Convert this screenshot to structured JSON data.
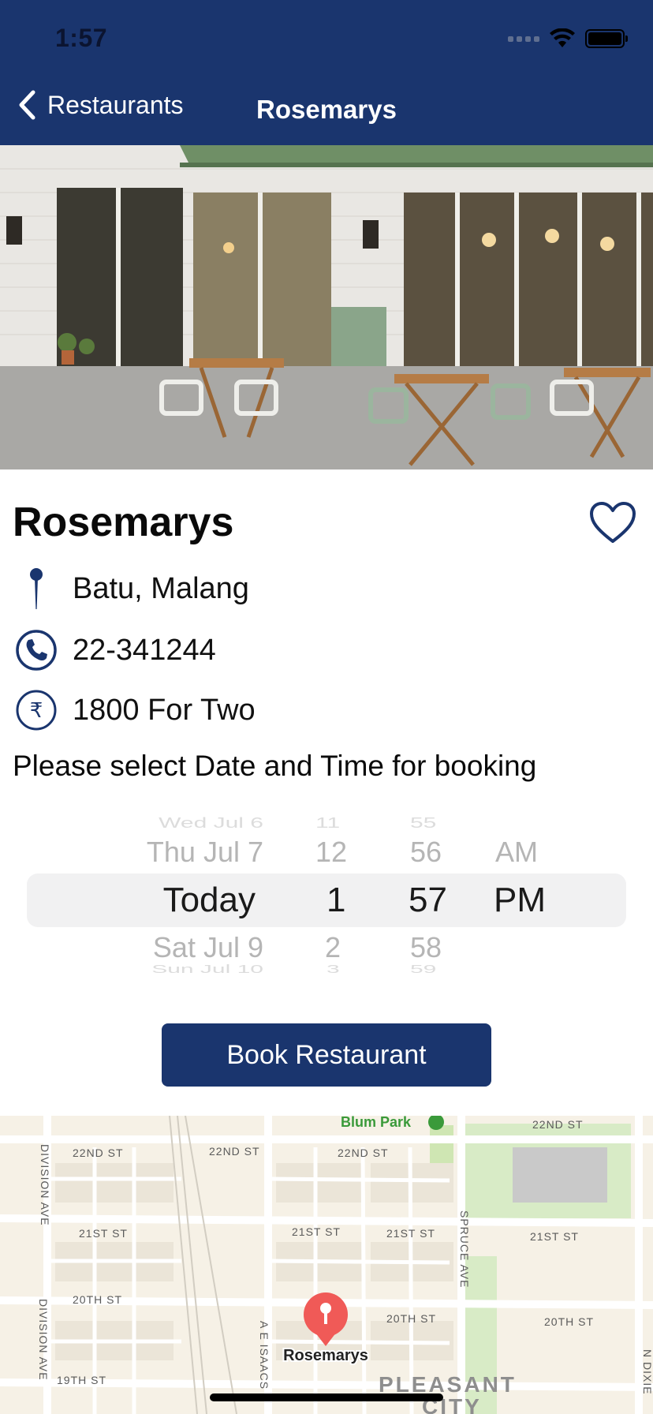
{
  "status_bar": {
    "time": "1:57"
  },
  "nav": {
    "back_label": "Restaurants",
    "title": "Rosemarys"
  },
  "restaurant": {
    "name": "Rosemarys",
    "location": "Batu, Malang",
    "phone": "22-341244",
    "price": "1800 For Two",
    "favorite": false
  },
  "booking": {
    "prompt": "Please select Date and Time for booking",
    "date_column": [
      "Wed Jul 6",
      "Thu Jul 7",
      "Today",
      "Sat Jul 9",
      "Sun Jul 10"
    ],
    "hour_column": [
      "11",
      "12",
      "1",
      "2",
      "3"
    ],
    "minute_column": [
      "55",
      "56",
      "57",
      "58",
      "59"
    ],
    "ampm_column": [
      "AM",
      "PM"
    ],
    "selected": {
      "date": "Today",
      "hour": "1",
      "minute": "57",
      "period": "PM"
    },
    "button_label": "Book Restaurant"
  },
  "map": {
    "pin_label": "Rosemarys",
    "park_label": "Blum Park",
    "street_labels": {
      "s22_a": "22ND ST",
      "s22_b": "22ND ST",
      "s22_c": "22ND ST",
      "s22_d": "22ND ST",
      "s21_a": "21ST ST",
      "s21_b": "21ST ST",
      "s21_c": "21ST ST",
      "s21_d": "21ST ST",
      "s20_a": "20TH ST",
      "s20_b": "20TH ST",
      "s20_c": "20TH ST",
      "s19_a": "19TH ST",
      "division_a": "DIVISION AVE",
      "division_b": "DIVISION AVE",
      "spruce": "SPRUCE AVE",
      "isaacs": "A E ISAACS",
      "dixie": "N DIXIE",
      "pleasant": "PLEASANT",
      "city": "CITY"
    }
  },
  "colors": {
    "brand": "#1a356e",
    "pin": "#f05a57",
    "park": "#cfe6b3"
  },
  "icons": [
    "chevron-left-icon",
    "wifi-icon",
    "battery-icon",
    "heart-icon",
    "map-pin-icon",
    "phone-icon",
    "rupee-icon"
  ]
}
